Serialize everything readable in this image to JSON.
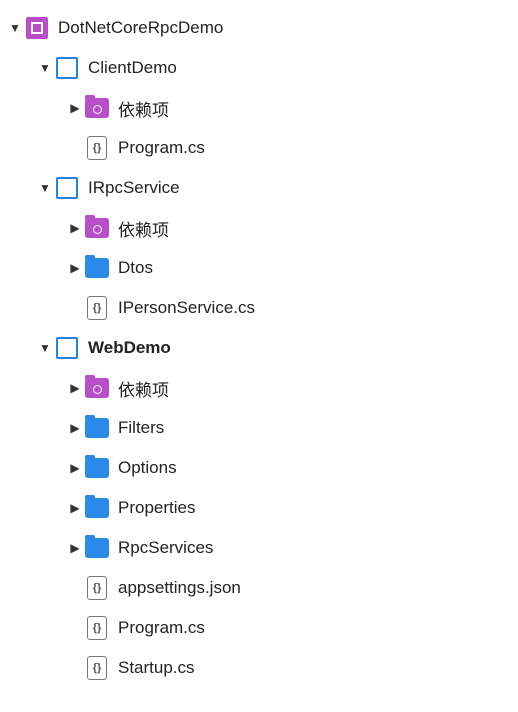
{
  "tree": [
    {
      "id": "sol",
      "depth": 0,
      "chev": "down",
      "icon": "solution",
      "label": "DotNetCoreRpcDemo",
      "bold": false,
      "interact": true
    },
    {
      "id": "p1",
      "depth": 1,
      "chev": "down",
      "icon": "project",
      "label": "ClientDemo",
      "bold": false,
      "interact": true
    },
    {
      "id": "p1d",
      "depth": 2,
      "chev": "right",
      "icon": "dep",
      "label": "依赖项",
      "bold": false,
      "interact": true
    },
    {
      "id": "p1f1",
      "depth": 2,
      "chev": "none",
      "icon": "cs",
      "label": "Program.cs",
      "bold": false,
      "interact": true
    },
    {
      "id": "p2",
      "depth": 1,
      "chev": "down",
      "icon": "project",
      "label": "IRpcService",
      "bold": false,
      "interact": true
    },
    {
      "id": "p2d",
      "depth": 2,
      "chev": "right",
      "icon": "dep",
      "label": "依赖项",
      "bold": false,
      "interact": true
    },
    {
      "id": "p2f1",
      "depth": 2,
      "chev": "right",
      "icon": "folder",
      "label": "Dtos",
      "bold": false,
      "interact": true
    },
    {
      "id": "p2f2",
      "depth": 2,
      "chev": "none",
      "icon": "cs",
      "label": "IPersonService.cs",
      "bold": false,
      "interact": true
    },
    {
      "id": "p3",
      "depth": 1,
      "chev": "down",
      "icon": "project",
      "label": "WebDemo",
      "bold": true,
      "interact": true
    },
    {
      "id": "p3d",
      "depth": 2,
      "chev": "right",
      "icon": "dep",
      "label": "依赖项",
      "bold": false,
      "interact": true
    },
    {
      "id": "p3f1",
      "depth": 2,
      "chev": "right",
      "icon": "folder",
      "label": "Filters",
      "bold": false,
      "interact": true
    },
    {
      "id": "p3f2",
      "depth": 2,
      "chev": "right",
      "icon": "folder",
      "label": "Options",
      "bold": false,
      "interact": true
    },
    {
      "id": "p3f3",
      "depth": 2,
      "chev": "right",
      "icon": "folder",
      "label": "Properties",
      "bold": false,
      "interact": true
    },
    {
      "id": "p3f4",
      "depth": 2,
      "chev": "right",
      "icon": "folder",
      "label": "RpcServices",
      "bold": false,
      "interact": true
    },
    {
      "id": "p3f5",
      "depth": 2,
      "chev": "none",
      "icon": "cs",
      "label": "appsettings.json",
      "bold": false,
      "interact": true
    },
    {
      "id": "p3f6",
      "depth": 2,
      "chev": "none",
      "icon": "cs",
      "label": "Program.cs",
      "bold": false,
      "interact": true
    },
    {
      "id": "p3f7",
      "depth": 2,
      "chev": "none",
      "icon": "cs",
      "label": "Startup.cs",
      "bold": false,
      "interact": true
    }
  ],
  "indentUnit": 30,
  "baseIndent": 6
}
